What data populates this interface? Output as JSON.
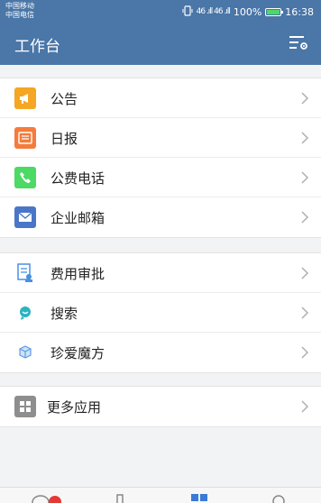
{
  "status_bar": {
    "carrier_1": "中国移动",
    "carrier_2": "中国电信",
    "signal_text": "46 .ıll 46 .ıll",
    "battery_text": "100%",
    "time": "16:38"
  },
  "app_bar": {
    "title": "工作台",
    "action_icon": "filter-settings-icon"
  },
  "groups": [
    {
      "items": [
        {
          "label": "公告",
          "icon": "megaphone-icon",
          "color": "#f5a623"
        },
        {
          "label": "日报",
          "icon": "report-icon",
          "color": "#f47c3c"
        },
        {
          "label": "公费电话",
          "icon": "phone-icon",
          "color": "#4cd964"
        },
        {
          "label": "企业邮箱",
          "icon": "mail-icon",
          "color": "#4a76c8"
        }
      ]
    },
    {
      "items": [
        {
          "label": "费用审批",
          "icon": "approval-doc-icon",
          "color": "#4a90e2"
        },
        {
          "label": "搜索",
          "icon": "chat-search-icon",
          "color": "#2bb3c0"
        },
        {
          "label": "珍爱魔方",
          "icon": "cube-icon",
          "color": "#5b9be6"
        }
      ]
    },
    {
      "items": [
        {
          "label": "更多应用",
          "icon": "grid-apps-icon",
          "color": "#8e8e8e"
        }
      ]
    }
  ],
  "tab_bar": {
    "tabs": [
      "messages-tab-icon",
      "contacts-tab-icon",
      "workbench-tab-icon",
      "profile-tab-icon"
    ],
    "active_color": "#3a7bd5"
  }
}
